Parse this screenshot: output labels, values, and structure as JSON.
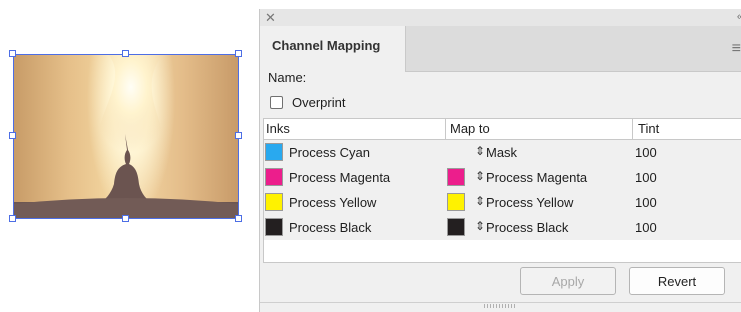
{
  "panel": {
    "title": "Channel Mapping",
    "name_label": "Name:",
    "overprint_label": "Overprint",
    "overprint_checked": false,
    "columns": {
      "inks": "Inks",
      "map_to": "Map to",
      "tint": "Tint"
    },
    "rows": [
      {
        "ink": "Process Cyan",
        "ink_color": "#29a9ef",
        "map": "Mask",
        "map_color": null,
        "tint": "100"
      },
      {
        "ink": "Process Magenta",
        "ink_color": "#ec1e8c",
        "map": "Process Magenta",
        "map_color": "#ec1e8c",
        "tint": "100"
      },
      {
        "ink": "Process Yellow",
        "ink_color": "#fff200",
        "map": "Process Yellow",
        "map_color": "#fff200",
        "tint": "100"
      },
      {
        "ink": "Process Black",
        "ink_color": "#231f20",
        "map": "Process Black",
        "map_color": "#231f20",
        "tint": "100"
      }
    ],
    "buttons": {
      "apply": "Apply",
      "revert": "Revert"
    },
    "apply_enabled": false
  },
  "icons": {
    "close": "close-icon",
    "collapse": "collapse-icon",
    "menu": "panel-menu-icon",
    "updown": "updown-arrows-icon"
  },
  "colors": {
    "selection": "#4d6ee5"
  }
}
